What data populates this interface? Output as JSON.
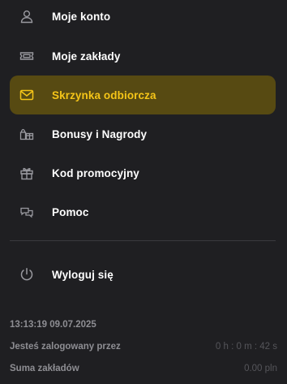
{
  "menu": {
    "items": [
      {
        "label": "Moje konto",
        "icon": "user-icon",
        "active": false
      },
      {
        "label": "Moje zakłady",
        "icon": "ticket-icon",
        "active": false
      },
      {
        "label": "Skrzynka odbiorcza",
        "icon": "mail-icon",
        "active": true
      },
      {
        "label": "Bonusy i Nagrody",
        "icon": "rewards-icon",
        "active": false
      },
      {
        "label": "Kod promocyjny",
        "icon": "gift-icon",
        "active": false
      },
      {
        "label": "Pomoc",
        "icon": "chat-icon",
        "active": false
      }
    ],
    "logout": {
      "label": "Wyloguj się",
      "icon": "power-icon"
    }
  },
  "footer": {
    "timestamp": "13:13:19 09.07.2025",
    "logged_in": {
      "label": "Jesteś zalogowany przez",
      "value": "0 h : 0 m : 42 s"
    },
    "bets_sum": {
      "label": "Suma zakładów",
      "value": "0.00 pln"
    }
  },
  "colors": {
    "background": "#1f1f22",
    "accent": "#f5c518",
    "active_background": "#574a12",
    "text": "#ffffff",
    "muted": "#8e8e93"
  }
}
